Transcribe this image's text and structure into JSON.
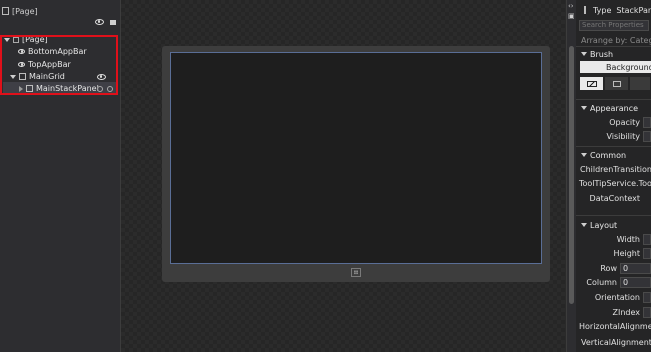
{
  "objects_panel": {
    "root_header": "[Page]",
    "tree": [
      {
        "label": "[Page]"
      },
      {
        "label": "BottomAppBar"
      },
      {
        "label": "TopAppBar"
      },
      {
        "label": "MainGrid"
      },
      {
        "label": "MainStackPanel"
      }
    ]
  },
  "properties": {
    "type_label": "Type",
    "type_value": "StackPanel",
    "search_placeholder": "Search Properties",
    "arrange_by": "Arrange by: Category",
    "brush": {
      "title": "Brush",
      "background_label": "Background"
    },
    "appearance": {
      "title": "Appearance",
      "opacity_label": "Opacity",
      "visibility_label": "Visibility"
    },
    "common": {
      "title": "Common",
      "children_transitions": "ChildrenTransitions (C",
      "tooltip": "ToolTipService.ToolTip",
      "datacontext": "DataContext"
    },
    "layout": {
      "title": "Layout",
      "width_label": "Width",
      "height_label": "Height",
      "row_label": "Row",
      "row_value": "0",
      "column_label": "Column",
      "column_value": "0",
      "orientation_label": "Orientation",
      "zindex_label": "ZIndex",
      "horizontal_alignment": "HorizontalAlignment",
      "vertical_alignment": "VerticalAlignment"
    }
  },
  "colors": {
    "selection_box": "#e0101a",
    "screen_border": "#5a6e96"
  }
}
